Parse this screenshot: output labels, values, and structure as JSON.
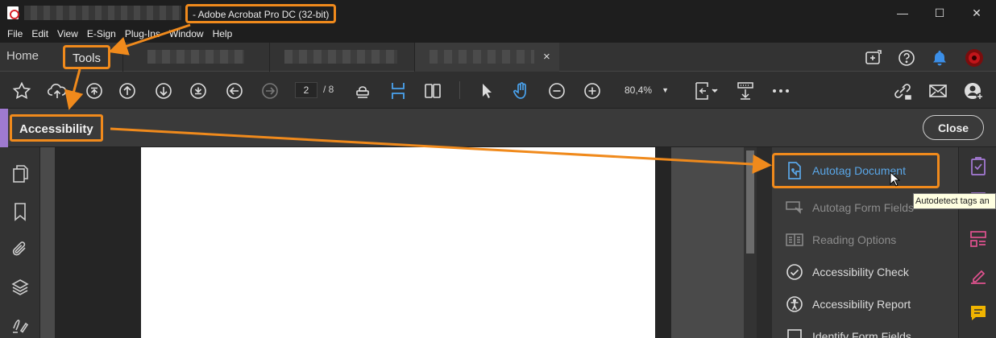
{
  "window": {
    "title": "- Adobe Acrobat Pro DC (32-bit)",
    "minimize_glyph": "—",
    "maximize_glyph": "☐",
    "close_glyph": "✕"
  },
  "menu": [
    "File",
    "Edit",
    "View",
    "E-Sign",
    "Plug-Ins",
    "Window",
    "Help"
  ],
  "tabs": {
    "home": "Home",
    "tools": "Tools",
    "doc_close": "×"
  },
  "toolbar": {
    "page_current": "2",
    "page_total": "/ 8",
    "zoom": "80,4%",
    "zoom_caret": "▼"
  },
  "accessibility_bar": {
    "title": "Accessibility",
    "close_label": "Close"
  },
  "tools_pane": {
    "items": [
      {
        "label": "Autotag Document",
        "icon": "autotag-document-icon",
        "state": "hover"
      },
      {
        "label": "Autotag Form Fields",
        "icon": "autotag-form-fields-icon",
        "state": "disabled"
      },
      {
        "label": "Reading Options",
        "icon": "reading-options-icon",
        "state": "disabled"
      },
      {
        "label": "Accessibility Check",
        "icon": "accessibility-check-icon",
        "state": "normal"
      },
      {
        "label": "Accessibility Report",
        "icon": "accessibility-report-icon",
        "state": "normal"
      },
      {
        "label": "Identify Form Fields",
        "icon": "identify-form-fields-icon",
        "state": "normal"
      }
    ],
    "tooltip": "Autodetect tags an"
  },
  "colors": {
    "annotation": "#f08a1c",
    "accent_purple": "#9f7ad0",
    "link_blue": "#5aa7e8",
    "disabled_text": "#8c8c8c",
    "notification_blue": "#3b8fe8"
  }
}
